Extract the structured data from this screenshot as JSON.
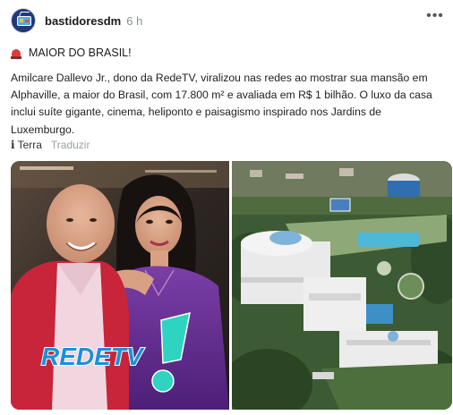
{
  "post": {
    "username": "bastidoresdm",
    "time": "6 h",
    "headline": "MAIOR DO BRASIL!",
    "body": "Amilcare Dallevo Jr., dono da RedeTV, viralizou nas redes ao mostrar sua mansão em Alphaville, a maior do Brasil, com 17.800 m² e avaliada em R$ 1 bilhão. O luxo da casa inclui suíte gigante, cinema, heliponto e paisagismo inspirado nos Jardins de Luxemburgo.",
    "source_label": "Terra",
    "translate_label": "Traduzir"
  },
  "images": {
    "left_logo_text": "REDETV",
    "left_logo_colors": {
      "text": "#1e8fd6",
      "mark": "#2fd3c2"
    }
  },
  "icons": {
    "avatar": "tv-avatar-icon",
    "more": "more-options-icon",
    "headline": "siren-icon",
    "info": "info-icon"
  }
}
